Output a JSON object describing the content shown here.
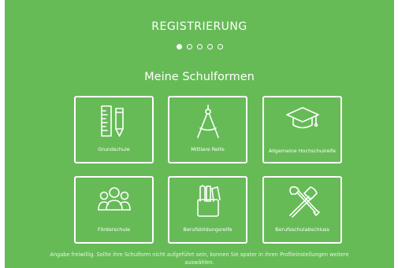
{
  "header": {
    "title": "REGISTRIERUNG",
    "steps": {
      "total": 5,
      "current": 1
    }
  },
  "section": {
    "heading": "Meine Schulformen"
  },
  "tiles": [
    {
      "label": "Grundschule",
      "icon": "ruler-pencil-icon"
    },
    {
      "label": "Mittlere Reife",
      "icon": "compass-icon"
    },
    {
      "label": "Allgemeine Hochschulreife",
      "icon": "graduation-cap-icon"
    },
    {
      "label": "Förderschule",
      "icon": "group-of-people-icon"
    },
    {
      "label": "Berufsbildungsreife",
      "icon": "pencil-cup-icon"
    },
    {
      "label": "Berufsschulabschluss",
      "icon": "hammer-wrench-icon"
    }
  ],
  "footer": {
    "note": "Angabe freiwillig. Sollte ihre Schulform nicht aufgeführt sein, konnen Sie spater in ihren Profileinstellungen weitere auswählen."
  },
  "colors": {
    "background": "#66bb57",
    "foreground": "#ffffff"
  }
}
